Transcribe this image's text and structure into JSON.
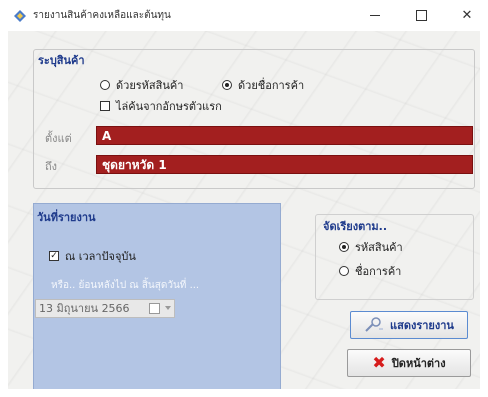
{
  "window": {
    "title": "รายงานสินค้าคงเหลือและต้นทุน",
    "controls": {
      "minimize": "—",
      "close": "✕"
    }
  },
  "product_group": {
    "title": "ระบุสินค้า",
    "radio_by_code": {
      "label": "ด้วยรหัสสินค้า",
      "checked": false
    },
    "radio_by_name": {
      "label": "ด้วยชื่อการค้า",
      "checked": true
    },
    "checkbox_first_letter": {
      "label": "ไล่ค้นจากอักษรตัวแรก",
      "checked": false
    },
    "from": {
      "label": "ตั้งแต่",
      "value": "A"
    },
    "to": {
      "label": "ถึง",
      "value": "ชุดยาหวัด 1"
    }
  },
  "report_date_group": {
    "title": "วันที่รายงาน",
    "checkbox_now": {
      "label": "ณ เวลาปัจจุบัน",
      "checked": true
    },
    "hint": "หรือ.. ย้อนหลังไป ณ สิ้นสุดวันที่ ...",
    "date_value": "13  มิถุนายน    2566"
  },
  "sort_group": {
    "title": "จัดเรียงตาม..",
    "radio_product_code": {
      "label": "รหัสสินค้า",
      "checked": true
    },
    "radio_trade_name": {
      "label": "ชื่อการค้า",
      "checked": false
    }
  },
  "buttons": {
    "show_report": "แสดงรายงาน",
    "close_page": "ปิดหน้าต่าง"
  },
  "colors": {
    "field_fill": "#a31f1f",
    "group_title": "#1f3b8c",
    "date_panel": "#b3c5e4",
    "close_icon": "#d61c1c"
  }
}
